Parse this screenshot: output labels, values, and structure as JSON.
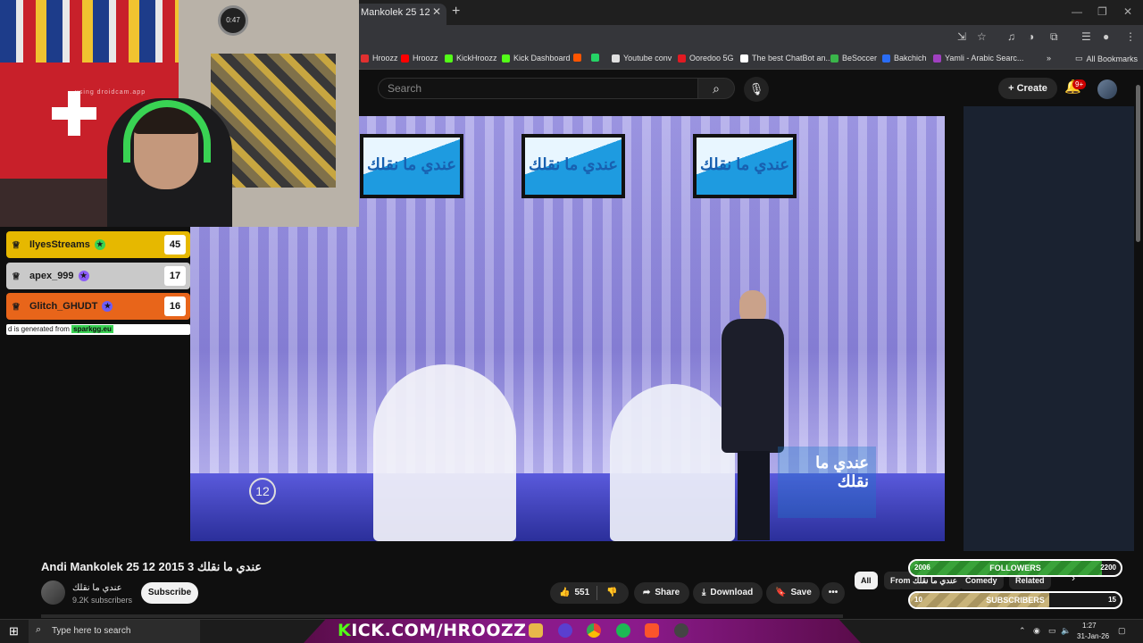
{
  "browser": {
    "tab_title": "Mankolek 25 12",
    "tab_close": "✕",
    "new_tab": "+",
    "bookmarks": [
      {
        "label": "Hroozz",
        "color": "#e03030"
      },
      {
        "label": "Hroozz",
        "color": "#ff0000"
      },
      {
        "label": "KickHroozz",
        "color": "#53fc18"
      },
      {
        "label": "Kick Dashboard",
        "color": "#53fc18"
      },
      {
        "label": "",
        "color": "#ff5500"
      },
      {
        "label": "",
        "color": "#25d366"
      },
      {
        "label": "Youtube conv",
        "color": "#e0e0e0"
      },
      {
        "label": "Ooredoo 5G",
        "color": "#e21a22"
      },
      {
        "label": "The best ChatBot an...",
        "color": "#ffffff"
      },
      {
        "label": "BeSoccer",
        "color": "#3ab54a"
      },
      {
        "label": "Bakchich",
        "color": "#2a6df5"
      },
      {
        "label": "Yamli - Arabic Searc...",
        "color": "#a040c0"
      }
    ],
    "all_bookmarks": "All Bookmarks",
    "more_bookmarks": "»"
  },
  "youtube_header": {
    "search_placeholder": "Search",
    "create_label": "Create",
    "notification_count": "9+"
  },
  "webcam": {
    "watermark": "using droidcam.app",
    "clock": "0:47"
  },
  "leaderboard": {
    "entries": [
      {
        "name": "IlyesStreams",
        "score": "45",
        "bg": "#e6b800",
        "color": "#1a1a1a",
        "badge_color": "#39d353"
      },
      {
        "name": "apex_999",
        "score": "17",
        "bg": "#c9c9c9",
        "color": "#1a1a1a",
        "badge_color": "#8b5cf6"
      },
      {
        "name": "Glitch_GHUDT",
        "score": "16",
        "bg": "#e8651a",
        "color": "#1a1a1a",
        "badge_color": "#6d5cf6"
      }
    ],
    "footer_text": "d is generated from",
    "footer_link": "sparkgg.eu"
  },
  "video": {
    "tv_text": "عندي ما نقلك",
    "logo_overlay": "عندي ما نقلك",
    "channel_number": "12"
  },
  "meta": {
    "title": "Andi Mankolek 25 12 2015 3 عندي ما نقلك",
    "channel_name": "عندي ما نقلك",
    "subscribers": "9.2K subscribers",
    "subscribe_label": "Subscribe",
    "likes": "551",
    "share_label": "Share",
    "download_label": "Download",
    "save_label": "Save",
    "more_label": "•••"
  },
  "chips": {
    "all": "All",
    "from": "From عندي ما نقلك",
    "comedy": "Comedy",
    "related": "Related",
    "next": "›"
  },
  "widgets": {
    "followers": {
      "label": "FOLLOWERS",
      "current": "2006",
      "goal": "2200",
      "progress": 0.91
    },
    "subscribers": {
      "label": "SUBSCRIBERS",
      "current": "10",
      "goal": "15",
      "progress": 0.66
    }
  },
  "taskbar": {
    "search_placeholder": "Type here to search",
    "kick_prefix": "K",
    "kick_text": "ICK.COM/HROOZZ",
    "time": "1:27",
    "date": "31-Jan-26"
  }
}
